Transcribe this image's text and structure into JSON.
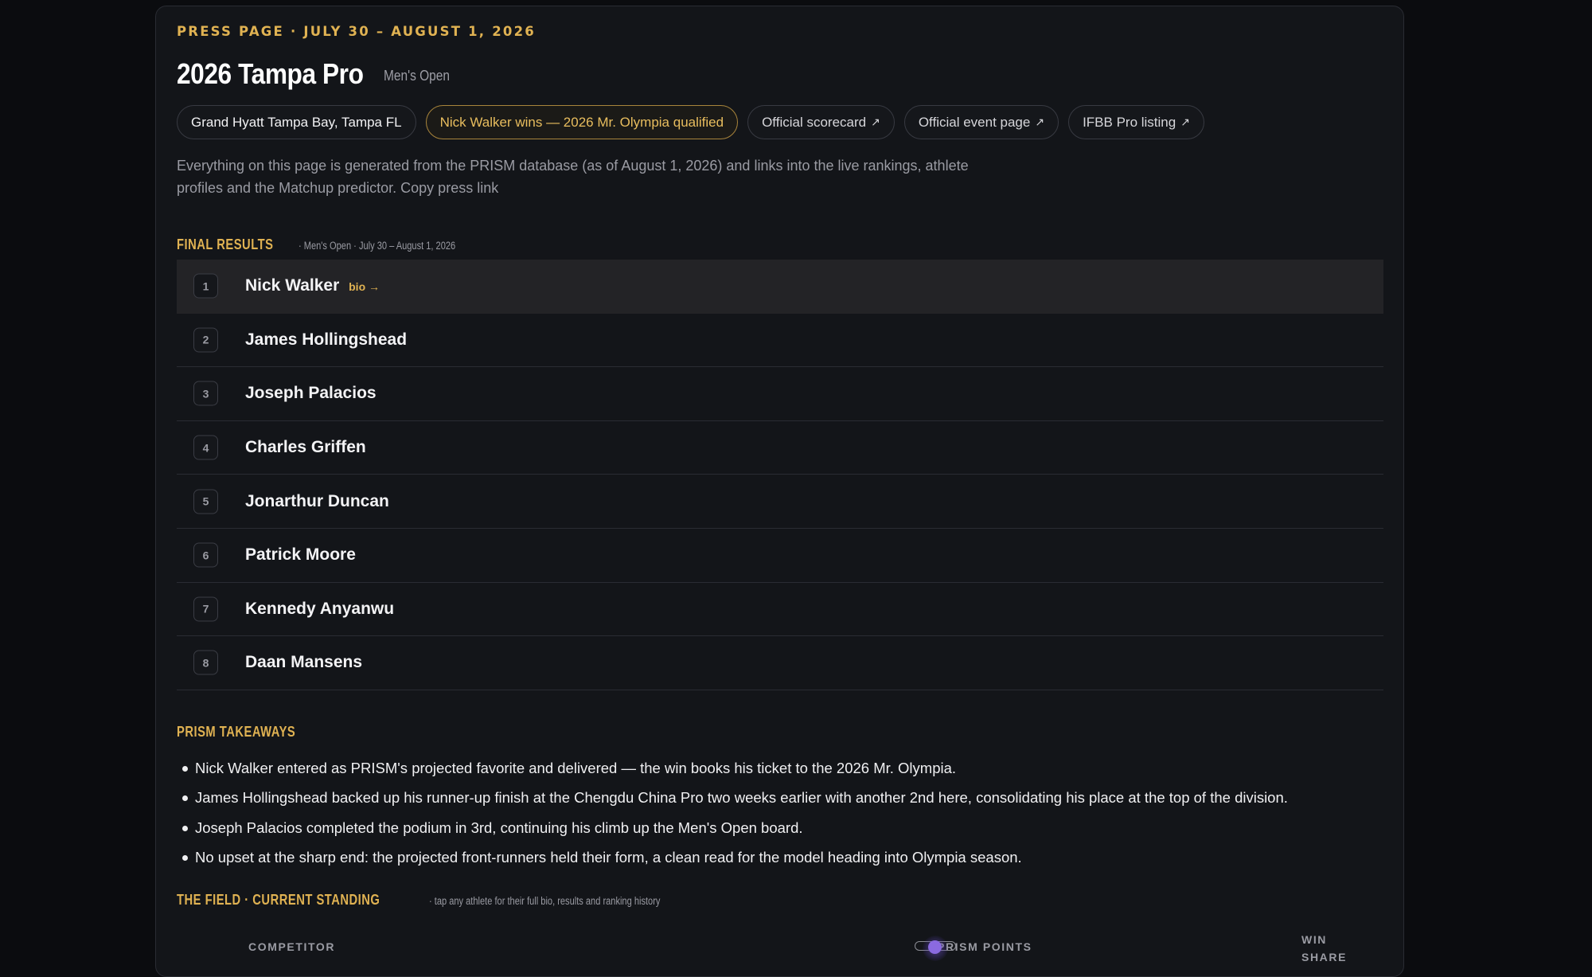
{
  "page": {
    "eyebrow": "PRESS PAGE · JULY 30 – AUGUST 1, 2026",
    "title": "2026 Tampa Pro",
    "division": "Men's Open",
    "chips": {
      "venue": "Grand Hyatt Tampa Bay, Tampa FL",
      "winner": "Nick Walker wins — 2026 Mr. Olympia qualified",
      "scorecard": "Official scorecard",
      "event_page": "Official event page",
      "ifbb": "IFBB Pro listing",
      "external_icon": "arrow-up-right-icon",
      "external_glyph": "↗"
    },
    "intro": "Everything on this page is generated from the PRISM database (as of August 1, 2026) and links into the live rankings, athlete profiles and the Matchup predictor. Copy press link"
  },
  "final_results": {
    "heading": "FINAL RESULTS",
    "sub": "· Men's Open · July 30 – August 1, 2026",
    "bio_link": "bio →",
    "rows": [
      {
        "rank": "1",
        "name": "Nick Walker"
      },
      {
        "rank": "2",
        "name": "James Hollingshead"
      },
      {
        "rank": "3",
        "name": "Joseph Palacios"
      },
      {
        "rank": "4",
        "name": "Charles Griffen"
      },
      {
        "rank": "5",
        "name": "Jonarthur Duncan"
      },
      {
        "rank": "6",
        "name": "Patrick Moore"
      },
      {
        "rank": "7",
        "name": "Kennedy Anyanwu"
      },
      {
        "rank": "8",
        "name": "Daan Mansens"
      }
    ]
  },
  "takeaways": {
    "heading": "PRISM TAKEAWAYS",
    "items": [
      "Nick Walker entered as PRISM's projected favorite and delivered — the win books his ticket to the 2026 Mr. Olympia.",
      "James Hollingshead backed up his runner-up finish at the Chengdu China Pro two weeks earlier with another 2nd here, consolidating his place at the top of the division.",
      "Joseph Palacios completed the podium in 3rd, continuing his climb up the Men's Open board.",
      "No upset at the sharp end: the projected front-runners held their form, a clean read for the model heading into Olympia season."
    ]
  },
  "field": {
    "heading": "THE FIELD · CURRENT STANDING",
    "sub": "· tap any athlete for their full bio, results and ranking history",
    "columns": {
      "competitor": "COMPETITOR",
      "points": "PRISM POINTS",
      "win_share_1": "WIN",
      "win_share_2": "SHARE"
    }
  },
  "colors": {
    "accent": "#e0b252",
    "background": "#0b0c0f",
    "card": "#131519",
    "toggle": "#8a6ae0"
  }
}
